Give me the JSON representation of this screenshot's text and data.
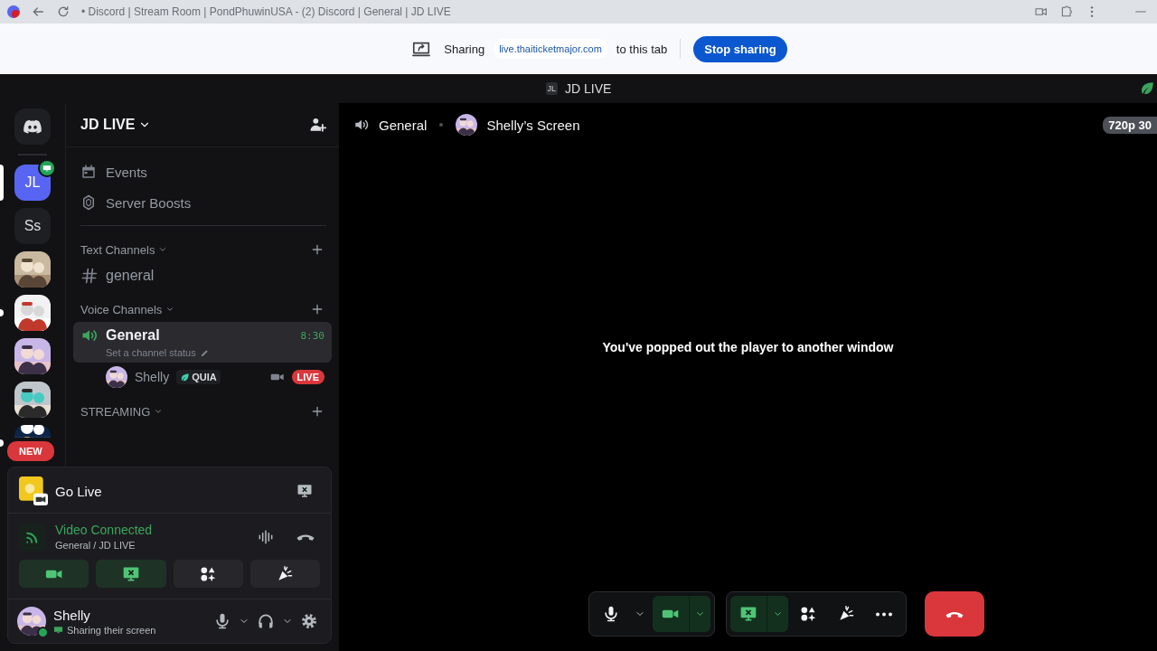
{
  "browser": {
    "tab_title": "• Discord | Stream Room | PondPhuwinUSA - (2) Discord | General | JD LIVE"
  },
  "share_bar": {
    "label": "Sharing",
    "site": "live.thaiticketmajor.com",
    "suffix": "to this tab",
    "button": "Stop sharing"
  },
  "app_bar": {
    "server_badge": "JL",
    "title": "JD LIVE"
  },
  "servers": [
    {
      "kind": "home",
      "selected": false,
      "unread": false
    },
    {
      "kind": "initials",
      "text": "JL",
      "selected": true,
      "unread": false,
      "streaming": true
    },
    {
      "kind": "initials",
      "text": "Ss",
      "selected": false,
      "unread": false,
      "streaming": false
    },
    {
      "kind": "picture",
      "selected": false,
      "unread": false
    },
    {
      "kind": "picture",
      "selected": false,
      "unread": true
    },
    {
      "kind": "picture",
      "selected": false,
      "unread": false
    },
    {
      "kind": "picture",
      "selected": false,
      "unread": false
    },
    {
      "kind": "picture",
      "selected": false,
      "unread": true,
      "badge": "NEW"
    }
  ],
  "sidebar": {
    "server_name": "JD LIVE",
    "items": [
      {
        "kind": "events",
        "label": "Events"
      },
      {
        "kind": "boosts",
        "label": "Server Boosts"
      }
    ],
    "categories": [
      {
        "name": "Text Channels",
        "channels": [
          {
            "kind": "text",
            "name": "general",
            "selected": false
          }
        ]
      },
      {
        "name": "Voice Channels",
        "channels": [
          {
            "kind": "voice",
            "name": "General",
            "selected": true,
            "time": "8:30",
            "status": "Set a channel status",
            "members": [
              {
                "name": "Shelly",
                "tag": "QUIA",
                "live": "LIVE"
              }
            ]
          }
        ]
      },
      {
        "name": "STREAMING"
      }
    ]
  },
  "panel": {
    "go_live": "Go Live",
    "connection": {
      "status": "Video Connected",
      "location": "General / JD LIVE"
    },
    "actions": [
      {
        "kind": "camera",
        "active": true
      },
      {
        "kind": "screen",
        "active": true
      },
      {
        "kind": "activities",
        "active": false
      },
      {
        "kind": "soundboard",
        "active": false
      }
    ],
    "user": {
      "name": "Shelly",
      "status": "Sharing their screen"
    }
  },
  "stage": {
    "voice_channel": "General",
    "screen_owner": "Shelly’s Screen",
    "quality": "720p 30",
    "message": "You've popped out the player to another window"
  },
  "control_groups": [
    {
      "buttons": [
        {
          "kind": "mic",
          "active": false,
          "menu": true
        },
        {
          "kind": "camera",
          "active": true,
          "menu": true
        }
      ]
    },
    {
      "buttons": [
        {
          "kind": "screen",
          "active": true,
          "menu": true
        },
        {
          "kind": "activities",
          "active": false
        },
        {
          "kind": "soundboard",
          "active": false
        },
        {
          "kind": "more",
          "active": false
        }
      ]
    }
  ],
  "hangup": {
    "kind": "hangup"
  }
}
